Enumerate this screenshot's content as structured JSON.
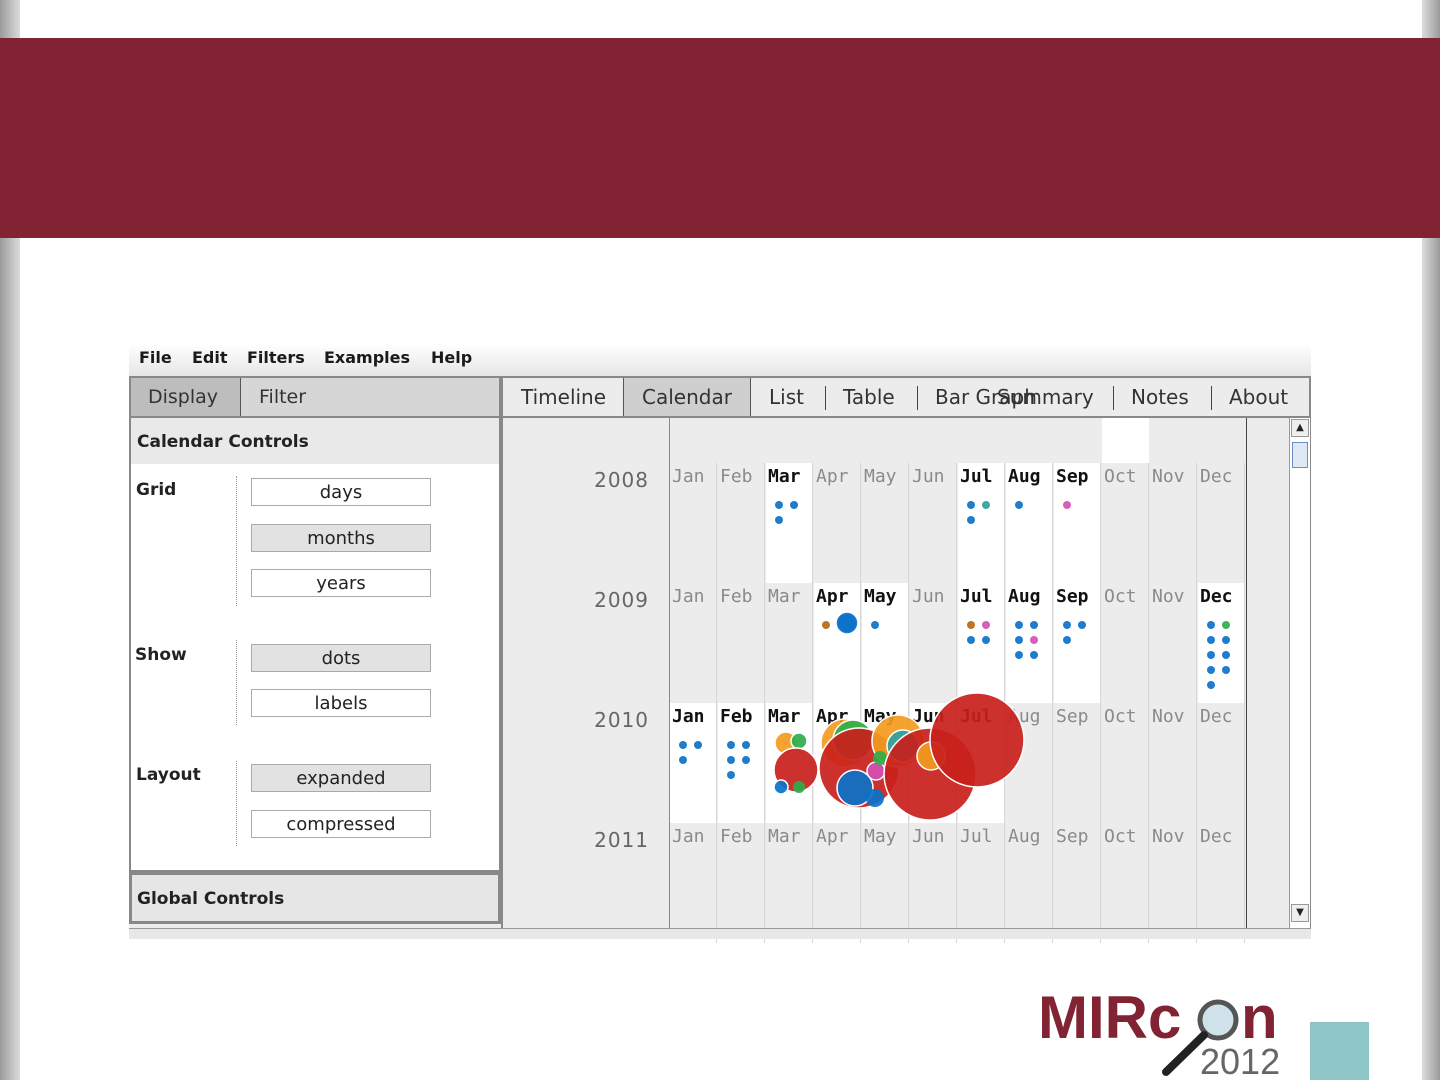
{
  "slide": {
    "banner_color": "#812333",
    "logo_text_main": "MIRcon",
    "logo_text_year": "2012",
    "teal_color": "#8ec5c7"
  },
  "menubar": {
    "items": [
      "File",
      "Edit",
      "Filters",
      "Examples",
      "Help"
    ]
  },
  "left_panel": {
    "tabs": [
      "Display",
      "Filter"
    ],
    "selected_tab": "Display",
    "calendar_controls": {
      "title": "Calendar Controls",
      "grid_label": "Grid",
      "grid_options": [
        "days",
        "months",
        "years"
      ],
      "grid_selected": "months",
      "show_label": "Show",
      "show_options": [
        "dots",
        "labels"
      ],
      "show_selected": "dots",
      "layout_label": "Layout",
      "layout_options": [
        "expanded",
        "compressed"
      ],
      "layout_selected": "expanded"
    },
    "global_controls_title": "Global Controls"
  },
  "right_panel": {
    "tabs": [
      "Timeline",
      "Calendar",
      "List",
      "Table",
      "Bar Graph",
      "Summary",
      "Notes",
      "About"
    ],
    "selected_tab": "Calendar",
    "calendar": {
      "years": [
        "2008",
        "2009",
        "2010",
        "2011"
      ],
      "months": [
        "Jan",
        "Feb",
        "Mar",
        "Apr",
        "May",
        "Jun",
        "Jul",
        "Aug",
        "Sep",
        "Oct",
        "Nov",
        "Dec"
      ],
      "active_months": {
        "2008": [
          "Mar",
          "Jul",
          "Aug",
          "Sep"
        ],
        "2009": [
          "Apr",
          "May",
          "Jul",
          "Aug",
          "Sep",
          "Dec"
        ],
        "2010": [
          "Jan",
          "Feb",
          "Mar",
          "Apr",
          "May",
          "Jun",
          "Jul"
        ],
        "2011": []
      }
    }
  }
}
